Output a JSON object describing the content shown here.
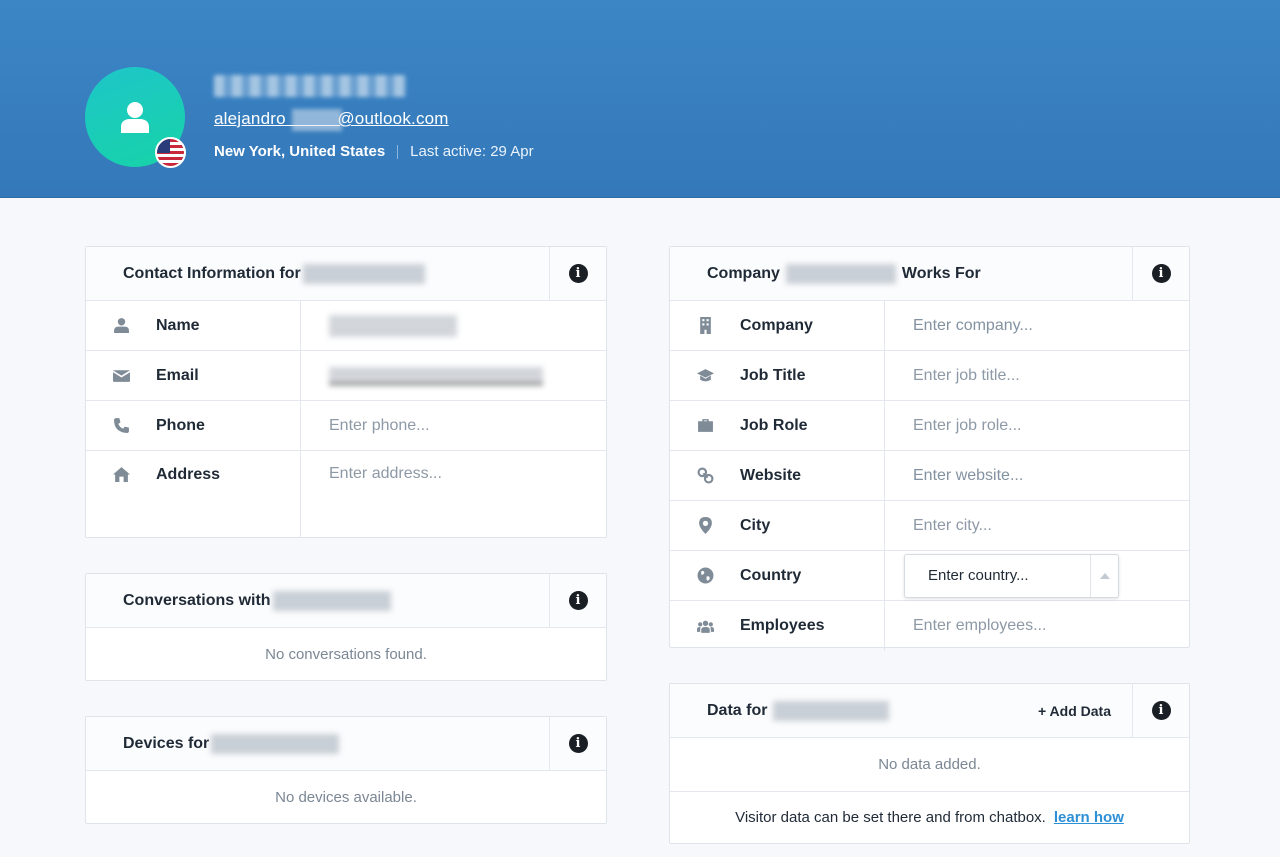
{
  "header": {
    "email": "alejandro   @outlook.com",
    "location": "New York, United States",
    "last_active": "Last active: 29 Apr"
  },
  "contact": {
    "title": "Contact Information for",
    "rows": [
      {
        "label": "Name",
        "icon": "user-icon",
        "value": ""
      },
      {
        "label": "Email",
        "icon": "envelope-icon",
        "value": ""
      },
      {
        "label": "Phone",
        "icon": "phone-icon",
        "placeholder": "Enter phone..."
      },
      {
        "label": "Address",
        "icon": "home-icon",
        "placeholder": "Enter address..."
      }
    ]
  },
  "conversations": {
    "title": "Conversations with",
    "empty": "No conversations found."
  },
  "devices": {
    "title": "Devices for",
    "empty": "No devices available."
  },
  "company": {
    "title_pre": "Company",
    "title_post": "Works For",
    "rows": [
      {
        "label": "Company",
        "icon": "building-icon",
        "placeholder": "Enter company..."
      },
      {
        "label": "Job Title",
        "icon": "graduation-cap-icon",
        "placeholder": "Enter job title..."
      },
      {
        "label": "Job Role",
        "icon": "briefcase-icon",
        "placeholder": "Enter job role..."
      },
      {
        "label": "Website",
        "icon": "link-icon",
        "placeholder": "Enter website..."
      },
      {
        "label": "City",
        "icon": "map-marker-icon",
        "placeholder": "Enter city..."
      },
      {
        "label": "Country",
        "icon": "globe-icon",
        "select_value": "Enter country..."
      },
      {
        "label": "Employees",
        "icon": "users-icon",
        "placeholder": "Enter employees..."
      }
    ]
  },
  "data_card": {
    "title": "Data for",
    "add_label": "+ Add Data",
    "empty": "No data added.",
    "footer_text": "Visitor data can be set there and from chatbox.",
    "footer_link": "learn how"
  },
  "colors": {
    "header_bg": "#3a82c3",
    "avatar": "#1ec6c0",
    "link": "#2d8fd6"
  }
}
